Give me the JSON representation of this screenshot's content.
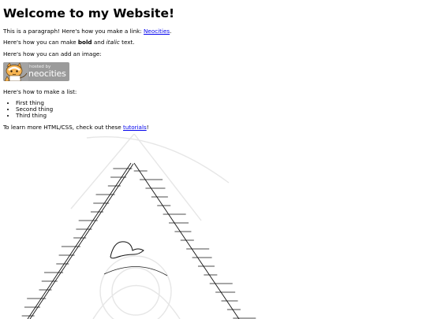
{
  "heading": "Welcome to my Website!",
  "intro": {
    "before": "This is a paragraph! Here's how you make a link: ",
    "link": "Neocities",
    "after": "."
  },
  "formatting": {
    "before": "Here's how you can make ",
    "bold": "bold",
    "middle": " and ",
    "italic": "italic",
    "after": " text."
  },
  "image_intro": "Here's how you can add an image:",
  "badge": {
    "small": "hosted by",
    "big": "neocities",
    "icon": "neocities-cat-icon",
    "background": "#9b9b9b"
  },
  "list_intro": "Here's how to make a list:",
  "list_items": [
    "First thing",
    "Second thing",
    "Third thing"
  ],
  "outro": {
    "before": "To learn more HTML/CSS, check out these ",
    "link": "tutorials",
    "after": "!"
  },
  "colors": {
    "link": "#0000ee",
    "text": "#000000",
    "background": "#ffffff"
  }
}
